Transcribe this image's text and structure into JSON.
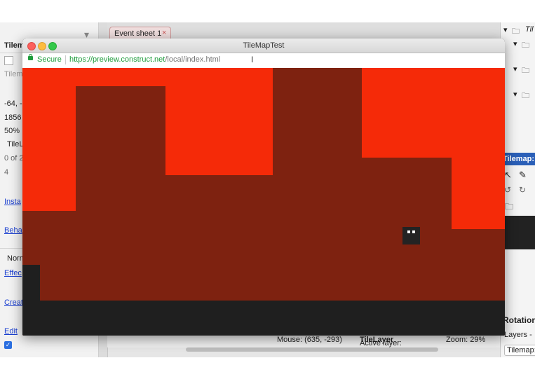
{
  "editor": {
    "event_tab_label": "Event sheet 1",
    "event_tab_close": "×",
    "left_panel": {
      "header": "Tilem",
      "field_faded": "Tilem",
      "position": "-64, -",
      "size": "1856",
      "opacity": "50%",
      "tile_field": "TileL",
      "count": "0 of 2",
      "number": "4",
      "instance_link": "Insta",
      "behaviors_link": "Beha",
      "blend": "Norm",
      "effects_link": "Effec",
      "create_link": "Creat",
      "edit_link": "Edit"
    },
    "right_panel": {
      "tree_label": "Til",
      "tilemap_header": "Tilemap: T",
      "rotation_label": "Rotation",
      "layers_tab": "Layers -",
      "tilemap_tab": "Tilemap: "
    },
    "status": {
      "mouse": "Mouse: (635, -293)",
      "active_layer_prefix": "Active layer: ",
      "active_layer_value": "TileLayer",
      "zoom": "Zoom: 29%"
    }
  },
  "browser": {
    "window_title": "TileMapTest",
    "secure_label": "Secure",
    "url_prefix": "https://preview.construct.net",
    "url_suffix": "/local/index.html"
  },
  "colors": {
    "sky": "#f52a08",
    "terrain": "#7e2210",
    "ground": "#1f1f1f",
    "secure_green": "#1e9c3c"
  }
}
